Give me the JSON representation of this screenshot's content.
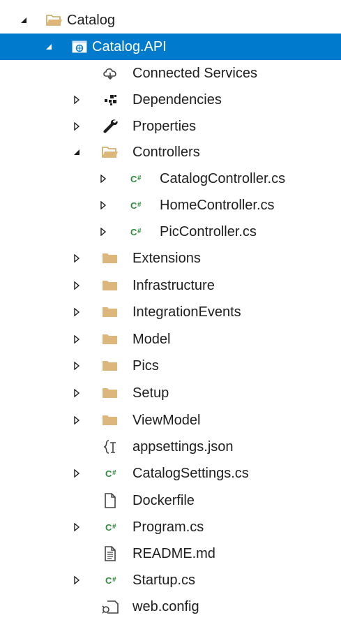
{
  "tree": {
    "items": [
      {
        "label": "Catalog",
        "icon": "folder-open-icon",
        "expander": "expanded"
      },
      {
        "label": "Catalog.API",
        "icon": "web-project-icon",
        "expander": "expanded",
        "selected": true
      },
      {
        "label": "Connected Services",
        "icon": "connected-services-icon",
        "expander": "none"
      },
      {
        "label": "Dependencies",
        "icon": "dependencies-icon",
        "expander": "collapsed"
      },
      {
        "label": "Properties",
        "icon": "wrench-icon",
        "expander": "collapsed"
      },
      {
        "label": "Controllers",
        "icon": "folder-open-icon",
        "expander": "expanded"
      },
      {
        "label": "CatalogController.cs",
        "icon": "csharp-file-icon",
        "expander": "collapsed"
      },
      {
        "label": "HomeController.cs",
        "icon": "csharp-file-icon",
        "expander": "collapsed"
      },
      {
        "label": "PicController.cs",
        "icon": "csharp-file-icon",
        "expander": "collapsed"
      },
      {
        "label": "Extensions",
        "icon": "folder-icon",
        "expander": "collapsed"
      },
      {
        "label": "Infrastructure",
        "icon": "folder-icon",
        "expander": "collapsed"
      },
      {
        "label": "IntegrationEvents",
        "icon": "folder-icon",
        "expander": "collapsed"
      },
      {
        "label": "Model",
        "icon": "folder-icon",
        "expander": "collapsed"
      },
      {
        "label": "Pics",
        "icon": "folder-icon",
        "expander": "collapsed"
      },
      {
        "label": "Setup",
        "icon": "folder-icon",
        "expander": "collapsed"
      },
      {
        "label": "ViewModel",
        "icon": "folder-icon",
        "expander": "collapsed"
      },
      {
        "label": "appsettings.json",
        "icon": "json-file-icon",
        "expander": "none"
      },
      {
        "label": "CatalogSettings.cs",
        "icon": "csharp-file-icon",
        "expander": "collapsed"
      },
      {
        "label": "Dockerfile",
        "icon": "file-icon",
        "expander": "none"
      },
      {
        "label": "Program.cs",
        "icon": "csharp-file-icon",
        "expander": "collapsed"
      },
      {
        "label": "README.md",
        "icon": "text-file-icon",
        "expander": "none"
      },
      {
        "label": "Startup.cs",
        "icon": "csharp-file-icon",
        "expander": "collapsed"
      },
      {
        "label": "web.config",
        "icon": "config-file-icon",
        "expander": "none"
      }
    ],
    "csharp_glyph": "C#",
    "colors": {
      "selection": "#007acc",
      "folder": "#dcb67a",
      "csharp": "#2e8b3e"
    }
  }
}
